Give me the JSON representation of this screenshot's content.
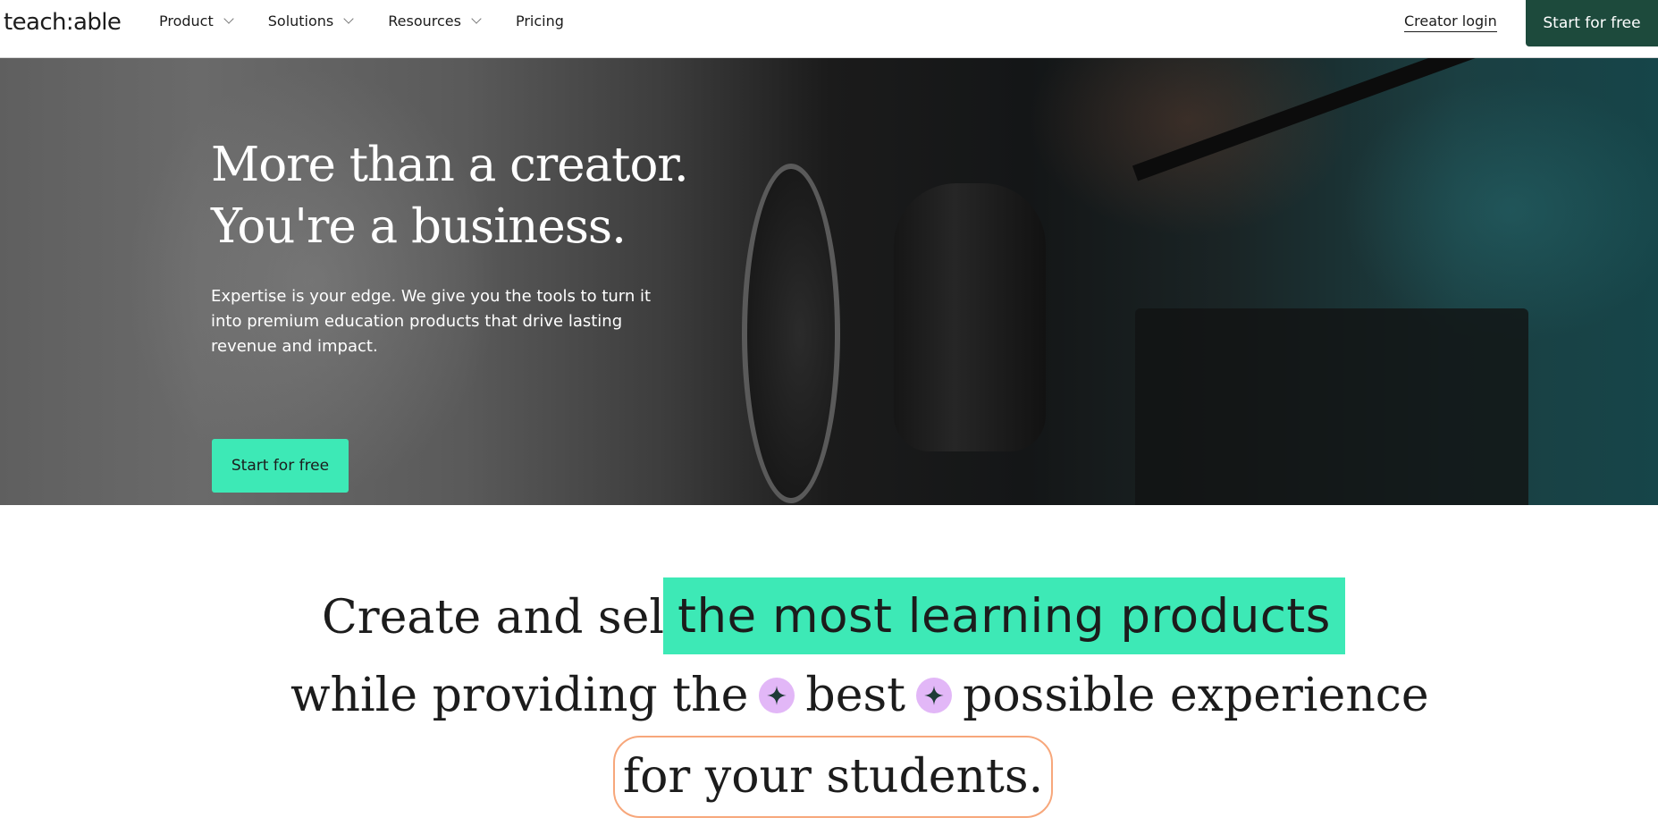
{
  "brand": {
    "logo_text": "teach:able"
  },
  "nav": {
    "items": [
      {
        "label": "Product",
        "has_dropdown": true
      },
      {
        "label": "Solutions",
        "has_dropdown": true
      },
      {
        "label": "Resources",
        "has_dropdown": true
      },
      {
        "label": "Pricing",
        "has_dropdown": false
      }
    ],
    "creator_login": "Creator login",
    "cta": "Start for free"
  },
  "hero": {
    "title_line1": "More than a creator.",
    "title_line2": "You're a business.",
    "subtitle": "Expertise is your edge. We give you the tools to turn it into premium education products that drive lasting revenue and impact.",
    "cta": "Start for free"
  },
  "statement": {
    "line1_prefix": "Create and sell",
    "highlight": "the most learning products",
    "line2_a": "while providing the",
    "line2_b": "best",
    "line2_c": "possible experience",
    "line3": "for your students."
  },
  "colors": {
    "header_cta_bg": "#1d4a3c",
    "accent_mint": "#3de9b6",
    "sparkle_bg": "#e2b7f7",
    "pill_border": "#f7a77b"
  }
}
